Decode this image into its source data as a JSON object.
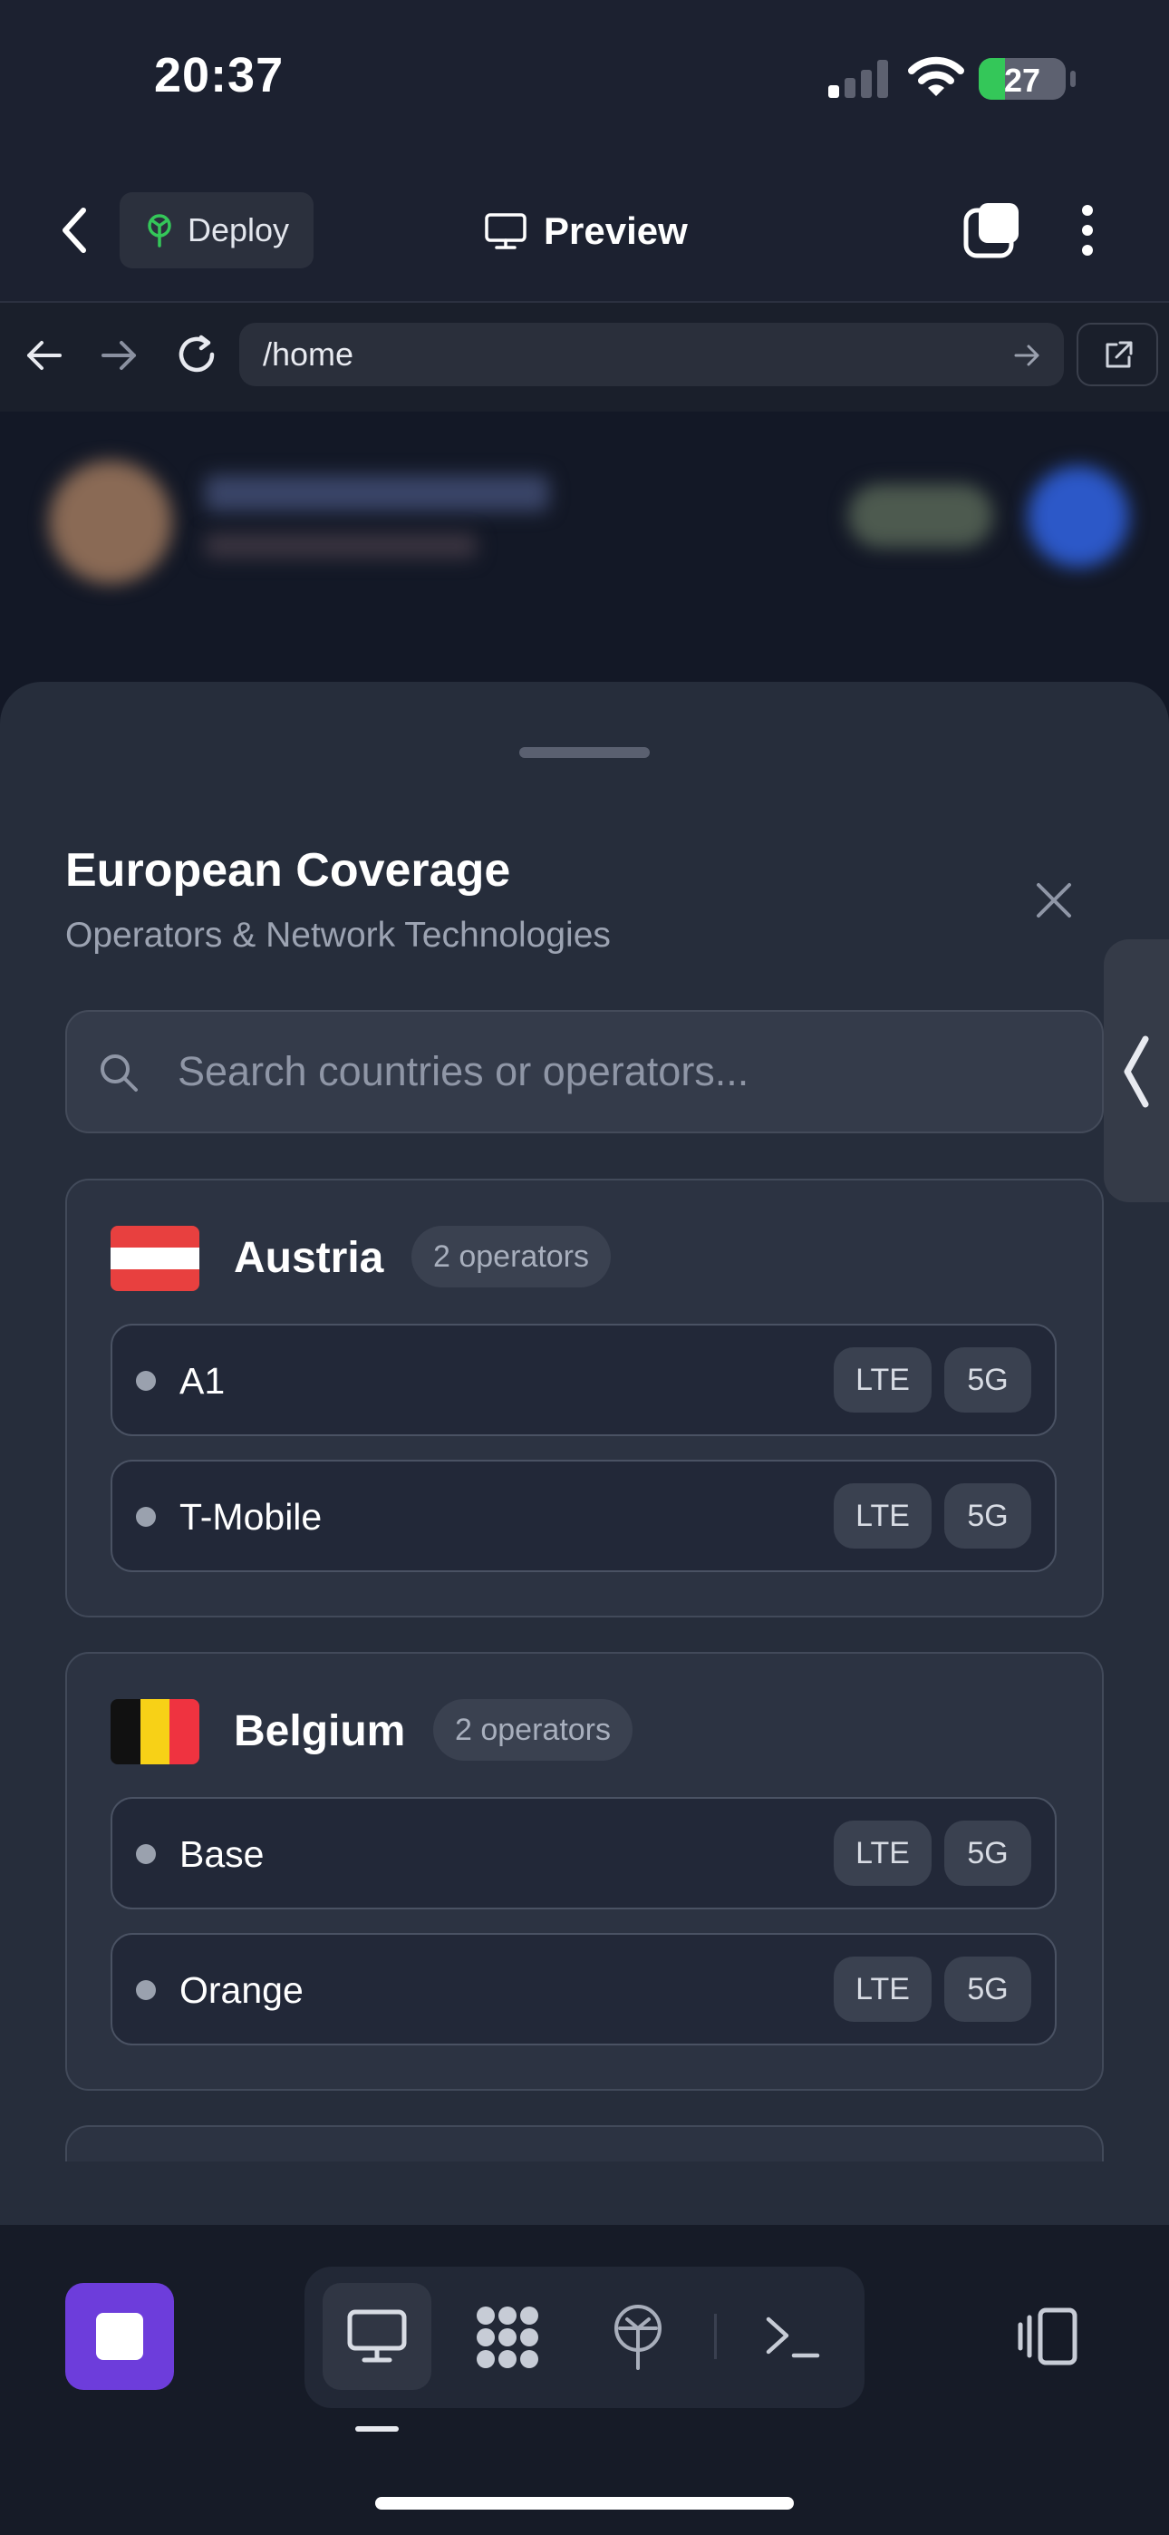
{
  "status_bar": {
    "time": "20:37",
    "battery": "27"
  },
  "app_bar": {
    "deploy_label": "Deploy",
    "title": "Preview"
  },
  "browser": {
    "url": "/home"
  },
  "sheet": {
    "title": "European Coverage",
    "subtitle": "Operators & Network Technologies",
    "search_placeholder": "Search countries or operators...",
    "countries": [
      {
        "name": "Austria",
        "count_label": "2 operators",
        "flag_colors": [
          "#e8403f",
          "#ffffff",
          "#e8403f"
        ],
        "operators": [
          {
            "name": "A1",
            "tags": [
              "LTE",
              "5G"
            ]
          },
          {
            "name": "T-Mobile",
            "tags": [
              "LTE",
              "5G"
            ]
          }
        ]
      },
      {
        "name": "Belgium",
        "count_label": "2 operators",
        "flag_colors": [
          "#111111",
          "#f7d117",
          "#ef3340"
        ],
        "operators": [
          {
            "name": "Base",
            "tags": [
              "LTE",
              "5G"
            ]
          },
          {
            "name": "Orange",
            "tags": [
              "LTE",
              "5G"
            ]
          }
        ]
      }
    ]
  },
  "colors": {
    "accent": "#6d3ddb",
    "background": "#1c2130",
    "sheet": "#262d3b"
  },
  "icons": {
    "status": [
      "signal-icon",
      "wifi-icon",
      "battery-icon"
    ],
    "app_bar": [
      "back-icon",
      "deploy-icon",
      "monitor-icon",
      "tabs-icon",
      "more-icon"
    ],
    "browser": [
      "browser-back-icon",
      "browser-forward-icon",
      "reload-icon",
      "go-arrow-icon",
      "open-external-icon"
    ],
    "bottom_tabs": [
      "preview-tab-icon",
      "graph-tab-icon",
      "deploy-tab-icon",
      "terminal-tab-icon",
      "device-toggle-icon"
    ]
  }
}
